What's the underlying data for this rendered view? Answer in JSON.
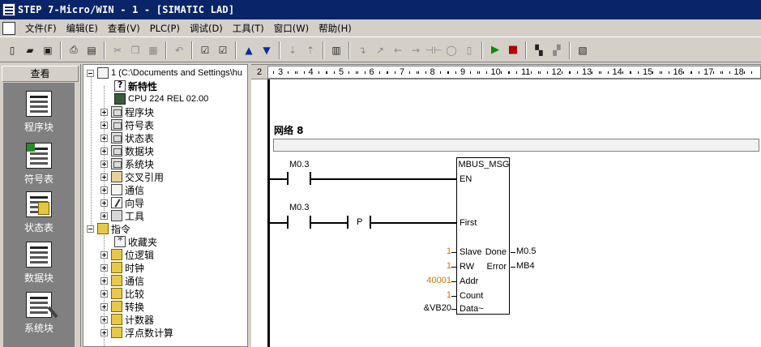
{
  "window": {
    "title": "STEP 7-Micro/WIN - 1 - [SIMATIC LAD]"
  },
  "menu": {
    "items": [
      "文件(F)",
      "编辑(E)",
      "查看(V)",
      "PLC(P)",
      "调试(D)",
      "工具(T)",
      "窗口(W)",
      "帮助(H)"
    ]
  },
  "toolbar": {
    "icons": [
      "new-icon",
      "open-icon",
      "save-icon",
      "print-icon",
      "print-preview-icon",
      "cut-icon",
      "copy-icon",
      "paste-icon",
      "undo-icon",
      "compile-icon",
      "compile-all-icon",
      "upload-icon",
      "download-icon",
      "sort-asc-icon",
      "sort-desc-icon",
      "options-icon",
      "insert-network-icon",
      "delete-network-icon",
      "run-icon",
      "stop-icon",
      "program-status-icon",
      "chart-status-icon"
    ]
  },
  "navbar": {
    "header": "查看",
    "items": [
      {
        "label": "程序块",
        "icon": "program-block-icon"
      },
      {
        "label": "符号表",
        "icon": "symbol-table-icon"
      },
      {
        "label": "状态表",
        "icon": "status-chart-icon"
      },
      {
        "label": "数据块",
        "icon": "data-block-icon"
      },
      {
        "label": "系统块",
        "icon": "system-block-icon"
      }
    ]
  },
  "tree": {
    "root": "1 (C:\\Documents and Settings\\hu",
    "items": [
      {
        "label": "新特性",
        "icon": "help-icon"
      },
      {
        "label": "CPU 224 REL 02.00",
        "icon": "cpu-icon"
      },
      {
        "label": "程序块",
        "icon": "program-block-icon"
      },
      {
        "label": "符号表",
        "icon": "symbol-table-icon"
      },
      {
        "label": "状态表",
        "icon": "status-chart-icon"
      },
      {
        "label": "数据块",
        "icon": "data-block-icon"
      },
      {
        "label": "系统块",
        "icon": "system-block-icon"
      },
      {
        "label": "交叉引用",
        "icon": "cross-reference-icon"
      },
      {
        "label": "通信",
        "icon": "communications-icon"
      },
      {
        "label": "向导",
        "icon": "wizard-icon"
      },
      {
        "label": "工具",
        "icon": "tools-icon"
      }
    ],
    "instructions": {
      "label": "指令",
      "items": [
        {
          "label": "收藏夹",
          "icon": "favorites-icon"
        },
        {
          "label": "位逻辑",
          "icon": "bit-logic-icon"
        },
        {
          "label": "时钟",
          "icon": "clock-icon"
        },
        {
          "label": "通信",
          "icon": "communications-icon"
        },
        {
          "label": "比较",
          "icon": "compare-icon"
        },
        {
          "label": "转换",
          "icon": "convert-icon"
        },
        {
          "label": "计数器",
          "icon": "counter-icon"
        },
        {
          "label": "浮点数计算",
          "icon": "float-math-icon"
        }
      ]
    }
  },
  "ruler": {
    "prefix": "2",
    "ticks": [
      "3",
      "4",
      "5",
      "6",
      "7",
      "8",
      "9",
      "10",
      "11",
      "12",
      "13",
      "14",
      "15",
      "16",
      "17",
      "18"
    ]
  },
  "network": {
    "title": "网络 8",
    "contact1": "M0.3",
    "contact2": "M0.3",
    "pbox": "P",
    "block": {
      "name": "MBUS_MSG",
      "pins_left": [
        "EN",
        "First",
        "Slave",
        "RW",
        "Addr",
        "Count",
        "Data~"
      ],
      "pins_right": [
        "Done",
        "Error"
      ],
      "inputs": {
        "slave": "1",
        "rw": "1",
        "addr": "40001",
        "count": "1",
        "data": "&VB20"
      },
      "outputs": {
        "done": "M0.5",
        "error": "MB4"
      }
    }
  }
}
